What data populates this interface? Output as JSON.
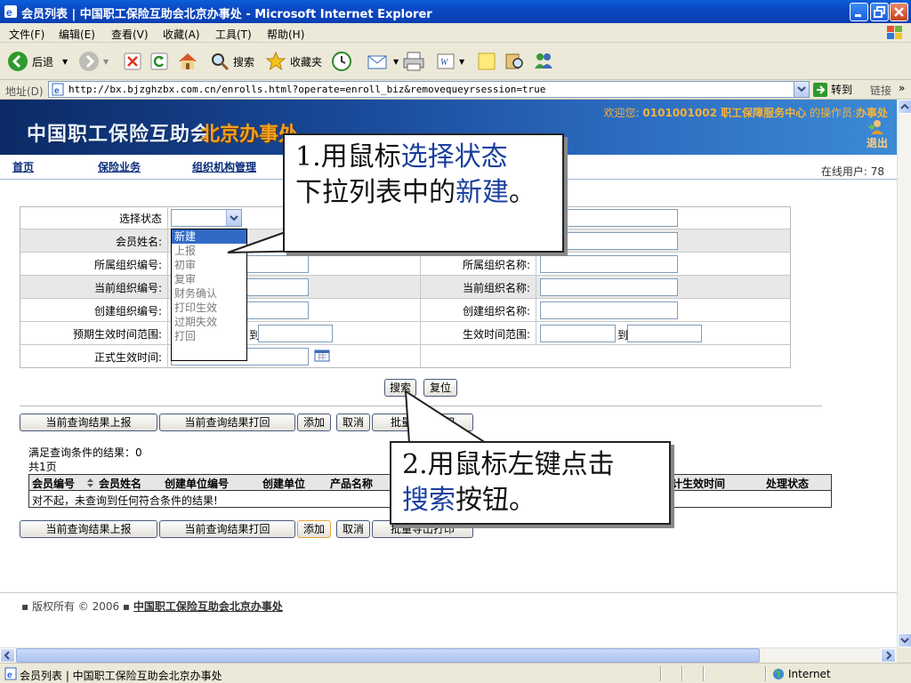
{
  "window": {
    "title": "会员列表 | 中国职工保险互助会北京办事处 - Microsoft Internet Explorer"
  },
  "menu": [
    "文件(F)",
    "编辑(E)",
    "查看(V)",
    "收藏(A)",
    "工具(T)",
    "帮助(H)"
  ],
  "toolbar": {
    "back": "后退",
    "search": "搜索",
    "favorites": "收藏夹"
  },
  "address": {
    "label": "地址(D)",
    "url": "http://bx.bjzghzbx.com.cn/enrolls.html?operate=enroll_biz&removequeyrsession=true",
    "go": "转到",
    "links": "链接"
  },
  "banner": {
    "org_name": "中国职工保险互助会",
    "org_sub": "北京办事处",
    "welcome_prefix": "欢迎您:",
    "welcome_user": "0101001002 职工保障服务中心",
    "welcome_role": "的操作员:",
    "welcome_role_value": "办事处",
    "logout": "退出"
  },
  "nav": {
    "home": "首页",
    "insurance": "保险业务",
    "org": "组织机构管理",
    "online": "在线用户: 78"
  },
  "form": {
    "status_label": "选择状态",
    "member_name_label": "会员姓名:",
    "org_code_label": "所属组织编号:",
    "org_name_label": "所属组织名称:",
    "cur_org_code_label": "当前组织编号:",
    "cur_org_name_label": "当前组织名称:",
    "create_org_code_label": "创建组织编号:",
    "create_org_name_label": "创建组织名称:",
    "expected_range_label": "预期生效时间范围:",
    "effective_range_label": "生效时间范围:",
    "formal_time_label": "正式生效时间:",
    "to": "到",
    "status_options": [
      "新建",
      "上报",
      "初审",
      "复审",
      "财务确认",
      "打印生效",
      "过期失效",
      "打回"
    ]
  },
  "buttons": {
    "search": "搜索",
    "reset": "复位",
    "report": "当前查询结果上报",
    "print": "当前查询结果打回",
    "add": "添加",
    "cancel": "取消",
    "batch_print": "批量导出打印"
  },
  "results": {
    "count_text": "满足查询条件的结果：0",
    "pages_text": "共1页",
    "columns": [
      "会员编号",
      "会员姓名",
      "创建单位编号",
      "创建单位",
      "产品名称",
      "预计生效时间",
      "处理状态"
    ],
    "empty": "对不起，未查询到任何符合条件的结果!"
  },
  "footer": {
    "copyright": "▪ 版权所有 © 2006 ▪",
    "org": "中国职工保险互助会北京办事处"
  },
  "callouts": {
    "step1_a": "1.用鼠标",
    "step1_b": "选择状态",
    "step1_c": "下拉列表中的",
    "step1_d": "新建",
    "step1_e": "。",
    "step2_a": "2.用鼠标左键点击",
    "step2_b": "搜索",
    "step2_c": "按钮。"
  },
  "status": {
    "text": "会员列表 | 中国职工保险互助会北京办事处",
    "zone": "Internet"
  },
  "colors": {
    "highlight": "#1a3f9c",
    "banner": "#0b2a66",
    "accent": "#f7b23a"
  }
}
